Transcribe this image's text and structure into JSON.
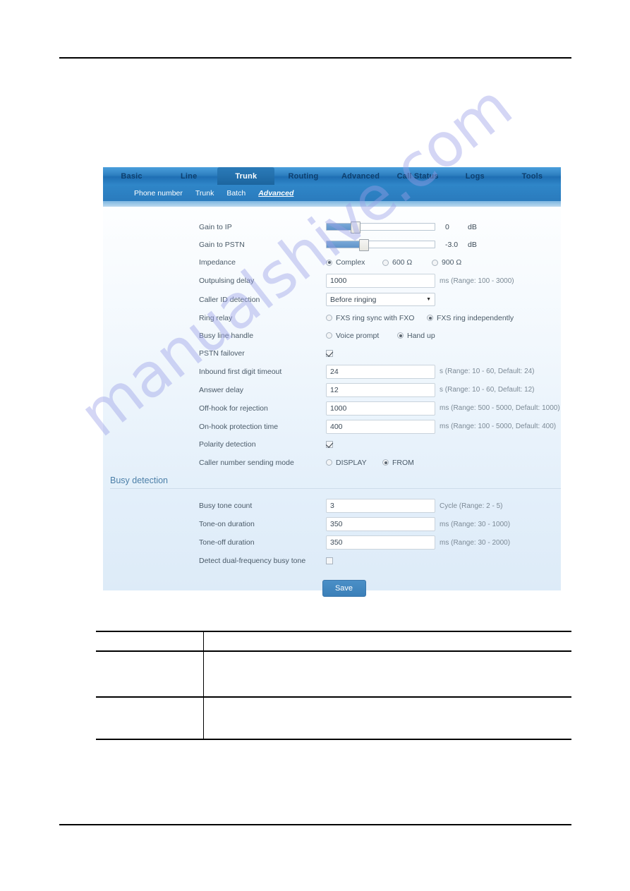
{
  "nav": {
    "tabs": [
      {
        "label": "Basic",
        "active": false
      },
      {
        "label": "Line",
        "active": false
      },
      {
        "label": "Trunk",
        "active": true
      },
      {
        "label": "Routing",
        "active": false
      },
      {
        "label": "Advanced",
        "active": false
      },
      {
        "label": "Call Status",
        "active": false
      },
      {
        "label": "Logs",
        "active": false
      },
      {
        "label": "Tools",
        "active": false
      }
    ],
    "subnav": [
      {
        "label": "Phone number",
        "current": false
      },
      {
        "label": "Trunk",
        "current": false
      },
      {
        "label": "Batch",
        "current": false
      },
      {
        "label": "Advanced",
        "current": true
      }
    ]
  },
  "form": {
    "gain_to_ip": {
      "label": "Gain to IP",
      "value": "0",
      "unit": "dB",
      "fill_percent": 26,
      "knob_percent": 26
    },
    "gain_to_pstn": {
      "label": "Gain to PSTN",
      "value": "-3.0",
      "unit": "dB",
      "fill_percent": 33,
      "knob_percent": 33
    },
    "impedance": {
      "label": "Impedance",
      "options": [
        {
          "label": "Complex",
          "selected": true
        },
        {
          "label": "600 Ω",
          "selected": false
        },
        {
          "label": "900 Ω",
          "selected": false
        }
      ]
    },
    "outpulsing_delay": {
      "label": "Outpulsing delay",
      "value": "1000",
      "hint": "ms (Range: 100 - 3000)"
    },
    "caller_id_detection": {
      "label": "Caller ID detection",
      "value": "Before ringing"
    },
    "ring_relay": {
      "label": "Ring relay",
      "options": [
        {
          "label": "FXS ring sync with FXO",
          "selected": false
        },
        {
          "label": "FXS ring independently",
          "selected": true
        }
      ]
    },
    "busy_line_handle": {
      "label": "Busy line handle",
      "options": [
        {
          "label": "Voice prompt",
          "selected": false
        },
        {
          "label": "Hand up",
          "selected": true
        }
      ]
    },
    "pstn_failover": {
      "label": "PSTN failover",
      "checked": true
    },
    "inbound_first_digit_timeout": {
      "label": "Inbound first digit timeout",
      "value": "24",
      "hint": "s (Range: 10 - 60, Default: 24)"
    },
    "answer_delay": {
      "label": "Answer delay",
      "value": "12",
      "hint": "s (Range: 10 - 60, Default: 12)"
    },
    "off_hook_for_rejection": {
      "label": "Off-hook for rejection",
      "value": "1000",
      "hint": "ms (Range: 500 - 5000, Default: 1000)"
    },
    "on_hook_protection_time": {
      "label": "On-hook protection time",
      "value": "400",
      "hint": "ms (Range: 100 - 5000, Default: 400)"
    },
    "polarity_detection": {
      "label": "Polarity detection",
      "checked": true
    },
    "caller_number_sending_mode": {
      "label": "Caller number sending mode",
      "options": [
        {
          "label": "DISPLAY",
          "selected": false
        },
        {
          "label": "FROM",
          "selected": true
        }
      ]
    }
  },
  "busy_detection": {
    "title": "Busy detection",
    "busy_tone_count": {
      "label": "Busy tone count",
      "value": "3",
      "hint": "Cycle (Range: 2 - 5)"
    },
    "tone_on_duration": {
      "label": "Tone-on duration",
      "value": "350",
      "hint": "ms (Range: 30 - 1000)"
    },
    "tone_off_duration": {
      "label": "Tone-off duration",
      "value": "350",
      "hint": "ms (Range: 30 - 2000)"
    },
    "detect_dual_frequency_busy_tone": {
      "label": "Detect dual-frequency busy tone",
      "checked": false
    }
  },
  "actions": {
    "save_label": "Save"
  },
  "watermark": {
    "text": "manualshive.com"
  },
  "colors": {
    "tab_active_bg": "#1c659f",
    "nav_bg": "#2e7fc0",
    "panel_top": "#fdfeff",
    "panel_bottom": "#ddebf8",
    "section_title": "#4c7fa8",
    "save_button": "#3b7fb8",
    "slider_fill": "#5f93c9",
    "label_text": "#4a5a68",
    "hint_text": "#7c8a96",
    "watermark": "#9aa0e8"
  }
}
